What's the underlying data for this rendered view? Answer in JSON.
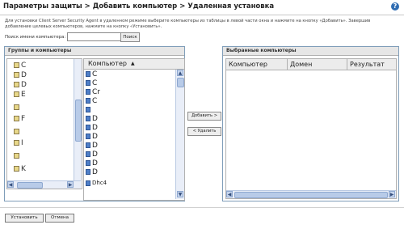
{
  "header": {
    "title": "Параметры защиты > Добавить компьютер > Удаленная установка",
    "help_icon": "help-icon"
  },
  "instructions": "Для установки Client Server Security Agent в удаленном режиме выберите компьютеры из таблицы в левой части окна и нажмите на кнопку «Добавить». Завершив добавление целевых компьютеров, нажмите на кнопку «Установить».",
  "search": {
    "label": "Поиск имени компьютера:",
    "value": "",
    "placeholder": "",
    "button_label": "Поиск"
  },
  "groups_panel": {
    "title": "Группы и компьютеры",
    "tree_items": [
      {
        "label": "C"
      },
      {
        "label": "D"
      },
      {
        "label": "D"
      },
      {
        "label": "E"
      },
      {
        "label": ""
      },
      {
        "label": "F"
      },
      {
        "label": ""
      },
      {
        "label": "I"
      },
      {
        "label": ""
      },
      {
        "label": "K"
      }
    ],
    "computer_column_header": "Компьютер",
    "computers": [
      "C",
      "C",
      "Cr",
      "C",
      "",
      "D",
      "D",
      "D",
      "D",
      "D",
      "D",
      "D",
      "Dhc4"
    ]
  },
  "buttons": {
    "add": "Добавить >",
    "remove": "< Удалить",
    "install": "Установить",
    "cancel": "Отмена"
  },
  "selected_panel": {
    "title": "Выбранные компьютеры",
    "columns": [
      "Компьютер",
      "Домен",
      "Результат"
    ]
  },
  "colors": {
    "panel_border": "#7f9db9",
    "scroll_thumb": "#b8cbe8",
    "header_bg": "#e6e6e6"
  }
}
